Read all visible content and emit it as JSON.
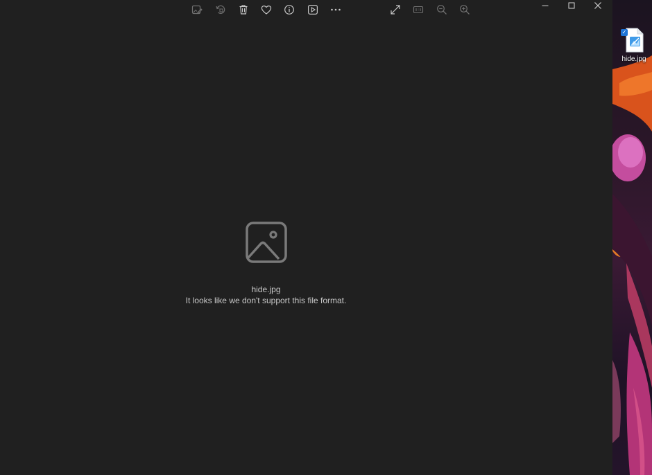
{
  "window": {
    "toolbar": {
      "edit": {
        "icon": "edit-image-icon",
        "tooltip": ""
      },
      "rotate": {
        "icon": "rotate-icon"
      },
      "delete": {
        "icon": "trash-icon"
      },
      "favorite": {
        "icon": "heart-icon"
      },
      "info": {
        "icon": "info-icon"
      },
      "slideshow": {
        "icon": "slideshow-icon"
      },
      "more": {
        "icon": "more-icon"
      },
      "fullscreen": {
        "icon": "expand-icon"
      },
      "actual_size": {
        "icon": "actual-size-icon"
      },
      "zoom_out": {
        "icon": "zoom-out-icon"
      },
      "zoom_in": {
        "icon": "zoom-in-icon"
      }
    },
    "controls": {
      "minimize": {
        "icon": "minimize-icon"
      },
      "maximize": {
        "icon": "maximize-icon"
      },
      "close": {
        "icon": "close-icon"
      }
    },
    "content": {
      "file_name": "hide.jpg",
      "message": "It looks like we don't support this file format.",
      "placeholder_icon": "image-placeholder-icon"
    },
    "colors": {
      "background": "#202020",
      "icon": "#c8c8c8",
      "icon_disabled": "#6f6f6f",
      "text": "#c8c8c8"
    }
  },
  "desktop": {
    "icon": {
      "label": "hide.jpg",
      "selected": true,
      "icon": "image-file-icon"
    }
  }
}
